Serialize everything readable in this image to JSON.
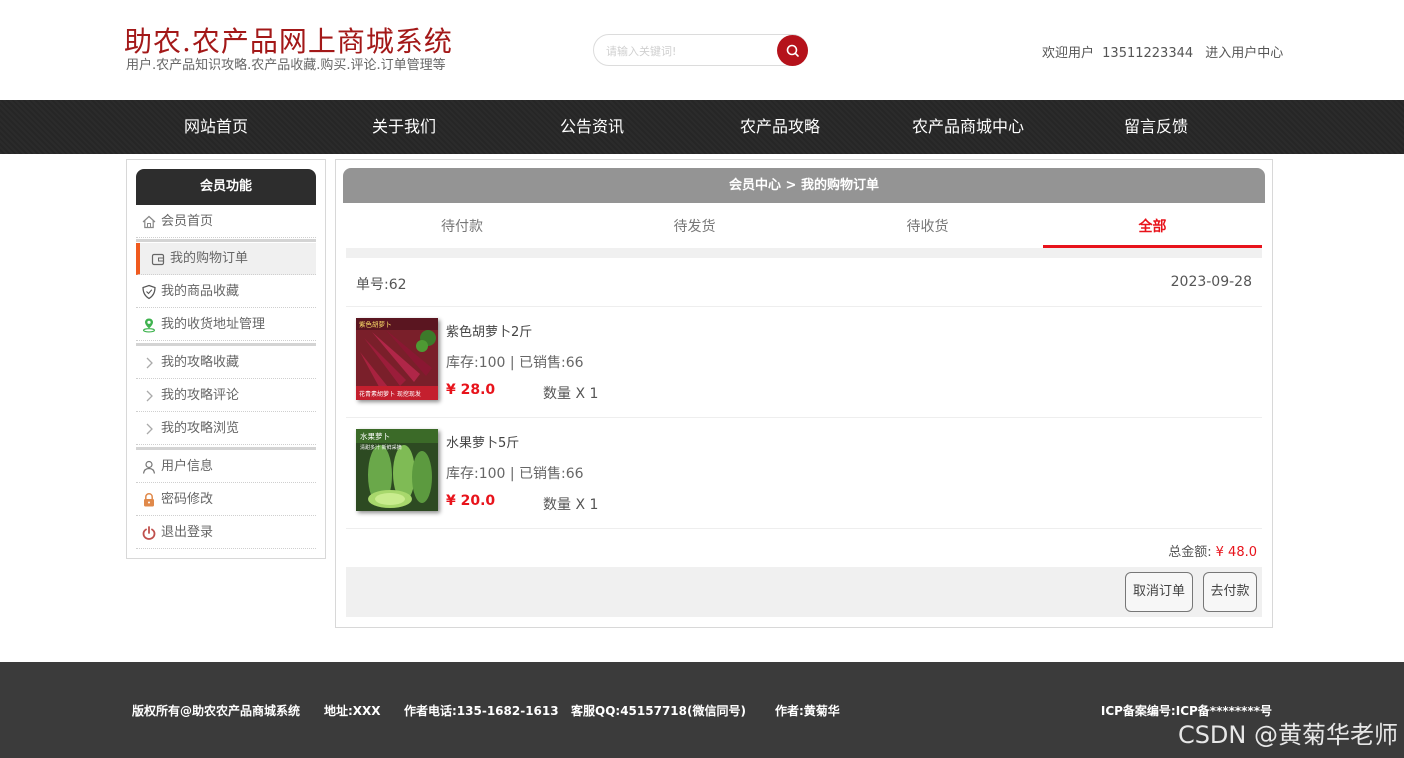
{
  "header": {
    "title": "助农.农产品网上商城系统",
    "subtitle": "用户.农产品知识攻略.农产品收藏.购买.评论.订单管理等",
    "search_placeholder": "请输入关键词!",
    "welcome_label": "欢迎用户",
    "phone": "13511223344",
    "user_center_link": "进入用户中心"
  },
  "nav": {
    "items": [
      "网站首页",
      "关于我们",
      "公告资讯",
      "农产品攻略",
      "农产品商城中心",
      "留言反馈"
    ]
  },
  "sidebar": {
    "title": "会员功能",
    "items": [
      {
        "label": "会员首页",
        "icon": "home-icon"
      },
      {
        "label": "我的购物订单",
        "icon": "wallet-icon"
      },
      {
        "label": "我的商品收藏",
        "icon": "shield-icon"
      },
      {
        "label": "我的收货地址管理",
        "icon": "location-icon"
      },
      {
        "label": "我的攻略收藏",
        "icon": "chevron-right-icon"
      },
      {
        "label": "我的攻略评论",
        "icon": "chevron-right-icon"
      },
      {
        "label": "我的攻略浏览",
        "icon": "chevron-right-icon"
      },
      {
        "label": "用户信息",
        "icon": "user-icon"
      },
      {
        "label": "密码修改",
        "icon": "lock-icon"
      },
      {
        "label": "退出登录",
        "icon": "power-icon"
      }
    ],
    "active_index": 1
  },
  "main": {
    "breadcrumb": "会员中心 > 我的购物订单",
    "tabs": [
      "待付款",
      "待发货",
      "待收货",
      "全部"
    ],
    "active_tab": 3,
    "order": {
      "number_label": "单号:",
      "number": "62",
      "date": "2023-09-28",
      "items": [
        {
          "name": "紫色胡萝卜2斤",
          "stock_text": "库存:100 | 已销售:66",
          "price": "¥ 28.0",
          "qty": "数量 X 1",
          "thumb_text_top": "紫色胡萝卜",
          "thumb_text_bottom": "花青素胡萝卜 现挖现发"
        },
        {
          "name": "水果萝卜5斤",
          "stock_text": "库存:100 | 已销售:66",
          "price": "¥ 20.0",
          "qty": "数量 X 1",
          "thumb_text_top": "水果萝卜",
          "thumb_text_bottom": "清甜多汁 新鲜采摘"
        }
      ],
      "total_label": "总金额:",
      "total": "¥ 48.0",
      "cancel_label": "取消订单",
      "pay_label": "去付款"
    }
  },
  "footer": {
    "copyright": "版权所有@助农农产品商城系统",
    "address": "地址:XXX",
    "phone": "作者电话:135-1682-1613",
    "qq": "客服QQ:45157718(微信同号)",
    "author": "作者:黄菊华",
    "icp": "ICP备案编号:ICP备********号",
    "watermark": "CSDN @黄菊华老师"
  },
  "colors": {
    "brand_red": "#a31818",
    "accent_red": "#e8131b",
    "nav_bg": "#262626",
    "active_marker": "#f05a1e",
    "footer_bg": "#3b3b3b"
  }
}
